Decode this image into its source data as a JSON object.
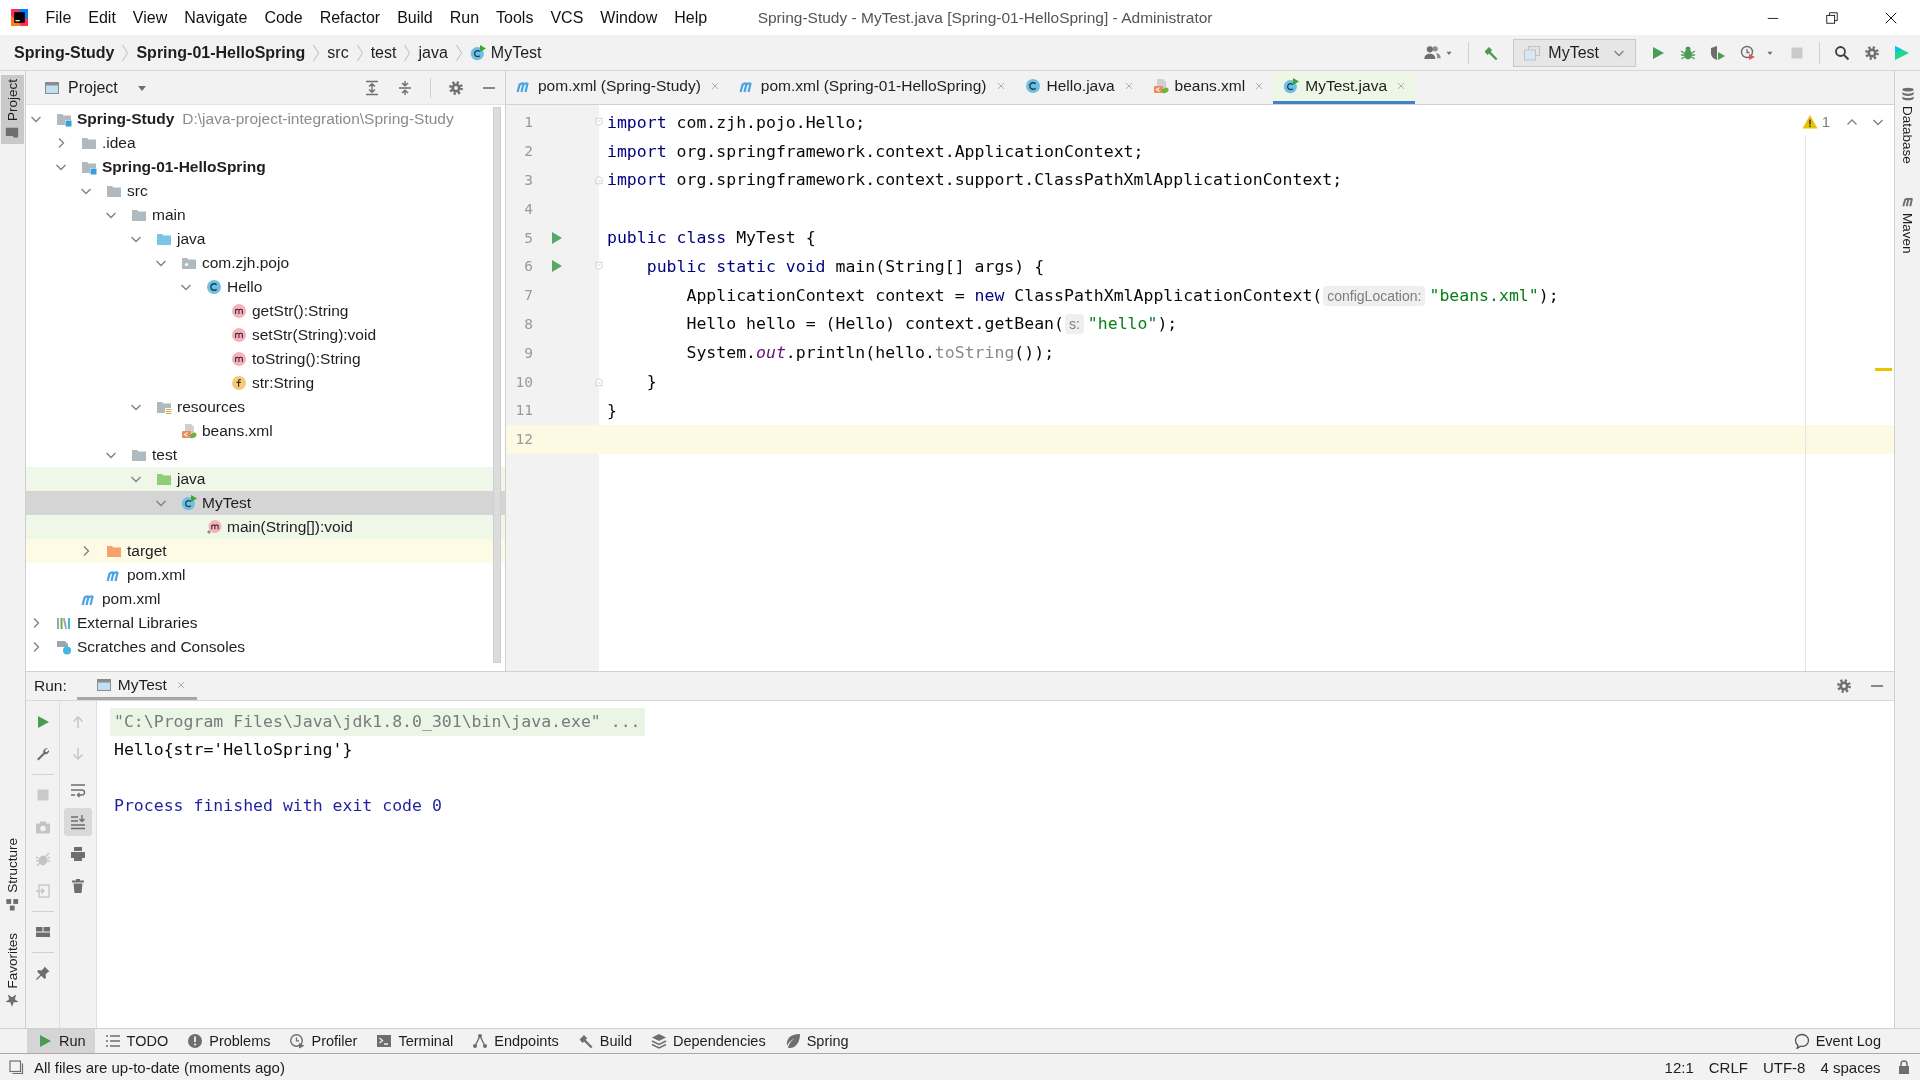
{
  "window": {
    "title": "Spring-Study - MyTest.java [Spring-01-HelloSpring] - Administrator"
  },
  "menu": [
    "File",
    "Edit",
    "View",
    "Navigate",
    "Code",
    "Refactor",
    "Build",
    "Run",
    "Tools",
    "VCS",
    "Window",
    "Help"
  ],
  "breadcrumb": [
    {
      "label": "Spring-Study",
      "kind": "module"
    },
    {
      "label": "Spring-01-HelloSpring",
      "kind": "module"
    },
    {
      "label": "src",
      "kind": "folder"
    },
    {
      "label": "test",
      "kind": "folder"
    },
    {
      "label": "java",
      "kind": "folder"
    },
    {
      "label": "MyTest",
      "kind": "test-class"
    }
  ],
  "toolbar": {
    "run_configuration": "MyTest"
  },
  "left_tool_windows": [
    {
      "label": "Project",
      "selected": true
    },
    {
      "label": "Structure",
      "selected": false
    },
    {
      "label": "Favorites",
      "selected": false
    }
  ],
  "right_tool_windows": [
    {
      "label": "Database",
      "selected": false
    },
    {
      "label": "Maven",
      "selected": false
    }
  ],
  "project_panel": {
    "title": "Project",
    "tree": [
      {
        "label": "Spring-Study",
        "kind": "module",
        "location": "D:\\java-project-integration\\Spring-Study",
        "expanded": true,
        "selected": false,
        "tests": false,
        "excluded": false,
        "children": [
          {
            "label": ".idea",
            "kind": "folder",
            "expanded": false,
            "selected": false,
            "tests": false,
            "excluded": false
          },
          {
            "label": "Spring-01-HelloSpring",
            "kind": "module",
            "expanded": true,
            "selected": false,
            "tests": false,
            "excluded": false,
            "children": [
              {
                "label": "src",
                "kind": "folder",
                "expanded": true,
                "selected": false,
                "tests": false,
                "excluded": false,
                "children": [
                  {
                    "label": "main",
                    "kind": "folder",
                    "expanded": true,
                    "selected": false,
                    "tests": false,
                    "excluded": false,
                    "children": [
                      {
                        "label": "java",
                        "kind": "source-root",
                        "expanded": true,
                        "selected": false,
                        "tests": false,
                        "excluded": false,
                        "children": [
                          {
                            "label": "com.zjh.pojo",
                            "kind": "package",
                            "expanded": true,
                            "selected": false,
                            "tests": false,
                            "excluded": false,
                            "children": [
                              {
                                "label": "Hello",
                                "kind": "class",
                                "expanded": true,
                                "selected": false,
                                "tests": false,
                                "excluded": false,
                                "children": [
                                  {
                                    "label": "getStr():String",
                                    "kind": "method",
                                    "selected": false,
                                    "tests": false,
                                    "excluded": false
                                  },
                                  {
                                    "label": "setStr(String):void",
                                    "kind": "method",
                                    "selected": false,
                                    "tests": false,
                                    "excluded": false
                                  },
                                  {
                                    "label": "toString():String",
                                    "kind": "method",
                                    "selected": false,
                                    "tests": false,
                                    "excluded": false
                                  },
                                  {
                                    "label": "str:String",
                                    "kind": "field",
                                    "selected": false,
                                    "tests": false,
                                    "excluded": false
                                  }
                                ]
                              }
                            ]
                          }
                        ]
                      },
                      {
                        "label": "resources",
                        "kind": "resources-root",
                        "expanded": true,
                        "selected": false,
                        "tests": false,
                        "excluded": false,
                        "children": [
                          {
                            "label": "beans.xml",
                            "kind": "spring-xml",
                            "selected": false,
                            "tests": false,
                            "excluded": false
                          }
                        ]
                      }
                    ]
                  },
                  {
                    "label": "test",
                    "kind": "folder",
                    "expanded": true,
                    "selected": false,
                    "tests": false,
                    "excluded": false,
                    "children": [
                      {
                        "label": "java",
                        "kind": "test-root",
                        "expanded": true,
                        "selected": false,
                        "tests": true,
                        "excluded": false,
                        "children": [
                          {
                            "label": "MyTest",
                            "kind": "test-class",
                            "expanded": true,
                            "selected": true,
                            "tests": false,
                            "excluded": false,
                            "children": [
                              {
                                "label": "main(String[]):void",
                                "kind": "main-method",
                                "selected": false,
                                "tests": true,
                                "excluded": false
                              }
                            ]
                          }
                        ]
                      }
                    ]
                  }
                ]
              },
              {
                "label": "target",
                "kind": "excluded-folder",
                "expanded": false,
                "selected": false,
                "tests": false,
                "excluded": true
              },
              {
                "label": "pom.xml",
                "kind": "maven",
                "selected": false,
                "tests": false,
                "excluded": false
              }
            ]
          },
          {
            "label": "pom.xml",
            "kind": "maven",
            "selected": false,
            "tests": false,
            "excluded": false
          }
        ]
      },
      {
        "label": "External Libraries",
        "kind": "libraries",
        "expanded": false,
        "selected": false,
        "tests": false,
        "excluded": false
      },
      {
        "label": "Scratches and Consoles",
        "kind": "scratches",
        "expanded": false,
        "selected": false,
        "tests": false,
        "excluded": false
      }
    ]
  },
  "editor": {
    "tabs": [
      {
        "label": "pom.xml (Spring-Study)",
        "kind": "maven",
        "selected": false,
        "tests": false
      },
      {
        "label": "pom.xml (Spring-01-HelloSpring)",
        "kind": "maven",
        "selected": false,
        "tests": false
      },
      {
        "label": "Hello.java",
        "kind": "class",
        "selected": false,
        "tests": false
      },
      {
        "label": "beans.xml",
        "kind": "spring-xml",
        "selected": false,
        "tests": false
      },
      {
        "label": "MyTest.java",
        "kind": "test-class",
        "selected": true,
        "tests": true
      }
    ],
    "warnings": "1",
    "lines": [
      {
        "number": "1",
        "fold_start": true,
        "fold_end": false,
        "run": false,
        "current": false,
        "tokens": [
          {
            "kind": "keyword",
            "text": "import"
          },
          {
            "kind": "plain",
            "text": " com.zjh.pojo.Hello;"
          }
        ]
      },
      {
        "number": "2",
        "fold_start": false,
        "fold_end": false,
        "run": false,
        "current": false,
        "tokens": [
          {
            "kind": "keyword",
            "text": "import"
          },
          {
            "kind": "plain",
            "text": " org.springframework.context.ApplicationContext;"
          }
        ]
      },
      {
        "number": "3",
        "fold_start": false,
        "fold_end": true,
        "run": false,
        "current": false,
        "tokens": [
          {
            "kind": "keyword",
            "text": "import"
          },
          {
            "kind": "plain",
            "text": " org.springframework.context.support.ClassPathXmlApplicationContext;"
          }
        ]
      },
      {
        "number": "4",
        "fold_start": false,
        "fold_end": false,
        "run": false,
        "current": false
      },
      {
        "number": "5",
        "fold_start": false,
        "fold_end": false,
        "run": true,
        "current": false,
        "tokens": [
          {
            "kind": "keyword",
            "text": "public class"
          },
          {
            "kind": "plain",
            "text": " MyTest {"
          }
        ]
      },
      {
        "number": "6",
        "fold_start": true,
        "fold_end": false,
        "run": true,
        "current": false,
        "tokens": [
          {
            "kind": "keyword",
            "text": "    public static void"
          },
          {
            "kind": "plain",
            "text": " main(String[] args) {"
          }
        ]
      },
      {
        "number": "7",
        "fold_start": false,
        "fold_end": false,
        "run": false,
        "current": false,
        "tokens": [
          {
            "kind": "plain",
            "text": "        ApplicationContext context = "
          },
          {
            "kind": "keyword",
            "text": "new"
          },
          {
            "kind": "plain",
            "text": " ClassPathXmlApplicationContext("
          },
          {
            "kind": "hint",
            "text": "configLocation:"
          },
          {
            "kind": "string",
            "text": "\"beans.xml\""
          },
          {
            "kind": "plain",
            "text": ");"
          }
        ]
      },
      {
        "number": "8",
        "fold_start": false,
        "fold_end": false,
        "run": false,
        "current": false,
        "tokens": [
          {
            "kind": "plain",
            "text": "        Hello hello = (Hello) context.getBean("
          },
          {
            "kind": "hint",
            "text": "s:"
          },
          {
            "kind": "string",
            "text": "\"hello\""
          },
          {
            "kind": "plain",
            "text": ");"
          }
        ]
      },
      {
        "number": "9",
        "fold_start": false,
        "fold_end": false,
        "run": false,
        "current": false,
        "tokens": [
          {
            "kind": "plain",
            "text": "        System."
          },
          {
            "kind": "static",
            "text": "out"
          },
          {
            "kind": "plain",
            "text": ".println(hello."
          },
          {
            "kind": "unused",
            "text": "toString"
          },
          {
            "kind": "plain",
            "text": "());"
          }
        ]
      },
      {
        "number": "10",
        "fold_start": false,
        "fold_end": true,
        "run": false,
        "current": false,
        "tokens": [
          {
            "kind": "plain",
            "text": "    }"
          }
        ]
      },
      {
        "number": "11",
        "fold_start": false,
        "fold_end": false,
        "run": false,
        "current": false,
        "tokens": [
          {
            "kind": "plain",
            "text": "}"
          }
        ]
      },
      {
        "number": "12",
        "fold_start": false,
        "fold_end": false,
        "run": false,
        "current": true
      }
    ]
  },
  "run_panel": {
    "label": "Run:",
    "tabs": [
      {
        "label": "MyTest",
        "selected": true
      }
    ],
    "console": [
      {
        "kind": "command",
        "text": "\"C:\\Program Files\\Java\\jdk1.8.0_301\\bin\\java.exe\" ..."
      },
      {
        "kind": "output",
        "text": "Hello{str='HelloSpring'}"
      },
      {
        "kind": "system",
        "text": "Process finished with exit code 0"
      }
    ]
  },
  "tool_window_bar": {
    "items": [
      {
        "label": "Run",
        "selected": true
      },
      {
        "label": "TODO",
        "selected": false
      },
      {
        "label": "Problems",
        "selected": false
      },
      {
        "label": "Profiler",
        "selected": false
      },
      {
        "label": "Terminal",
        "selected": false
      },
      {
        "label": "Endpoints",
        "selected": false
      },
      {
        "label": "Build",
        "selected": false
      },
      {
        "label": "Dependencies",
        "selected": false
      },
      {
        "label": "Spring",
        "selected": false
      }
    ],
    "event_log": "Event Log"
  },
  "status_bar": {
    "message": "All files are up-to-date (moments ago)",
    "position": "12:1",
    "line_separator": "CRLF",
    "encoding": "UTF-8",
    "indent": "4 spaces"
  }
}
